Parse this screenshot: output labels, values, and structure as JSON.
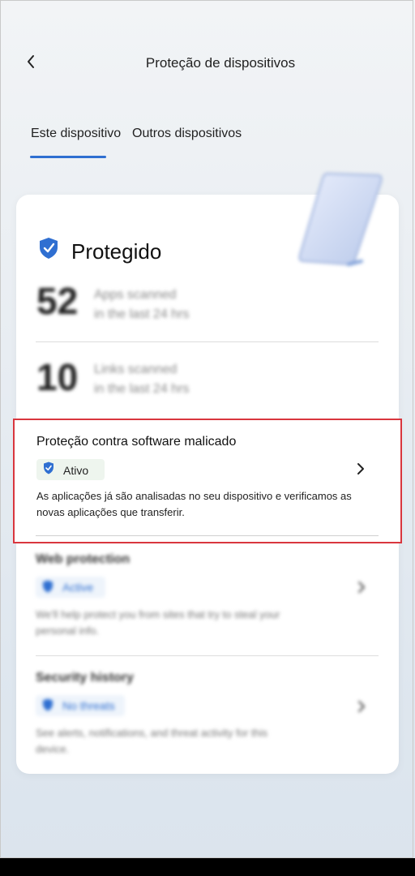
{
  "header": {
    "title": "Proteção de dispositivos",
    "back_icon": "chevron-left-icon"
  },
  "tabs": [
    {
      "label": "Este dispositivo",
      "selected": true
    },
    {
      "label": "Outros dispositivos",
      "selected": false
    }
  ],
  "colors": {
    "accent": "#2f6fd1",
    "highlight_border": "#d9363e",
    "active_pill_bg": "#eef5ee"
  },
  "status": {
    "label": "Protegido",
    "icon": "shield-check-icon"
  },
  "stats": [
    {
      "value": "52",
      "text_line1": "Apps scanned",
      "text_line2": "in the last 24 hrs"
    },
    {
      "value": "10",
      "text_line1": "Links scanned",
      "text_line2": "in the last 24 hrs"
    }
  ],
  "malware": {
    "title": "Proteção contra software malicado",
    "badge": "Ativo",
    "description": "As aplicações já são analisadas no seu dispositivo e verificamos as novas aplicações que transferir."
  },
  "web_protection": {
    "title": "Web protection",
    "badge": "Active",
    "description": "We'll help protect you from sites that try to steal your personal info."
  },
  "security_history": {
    "title": "Security history",
    "badge": "No threats",
    "description": "See alerts, notifications, and threat activity for this device."
  }
}
